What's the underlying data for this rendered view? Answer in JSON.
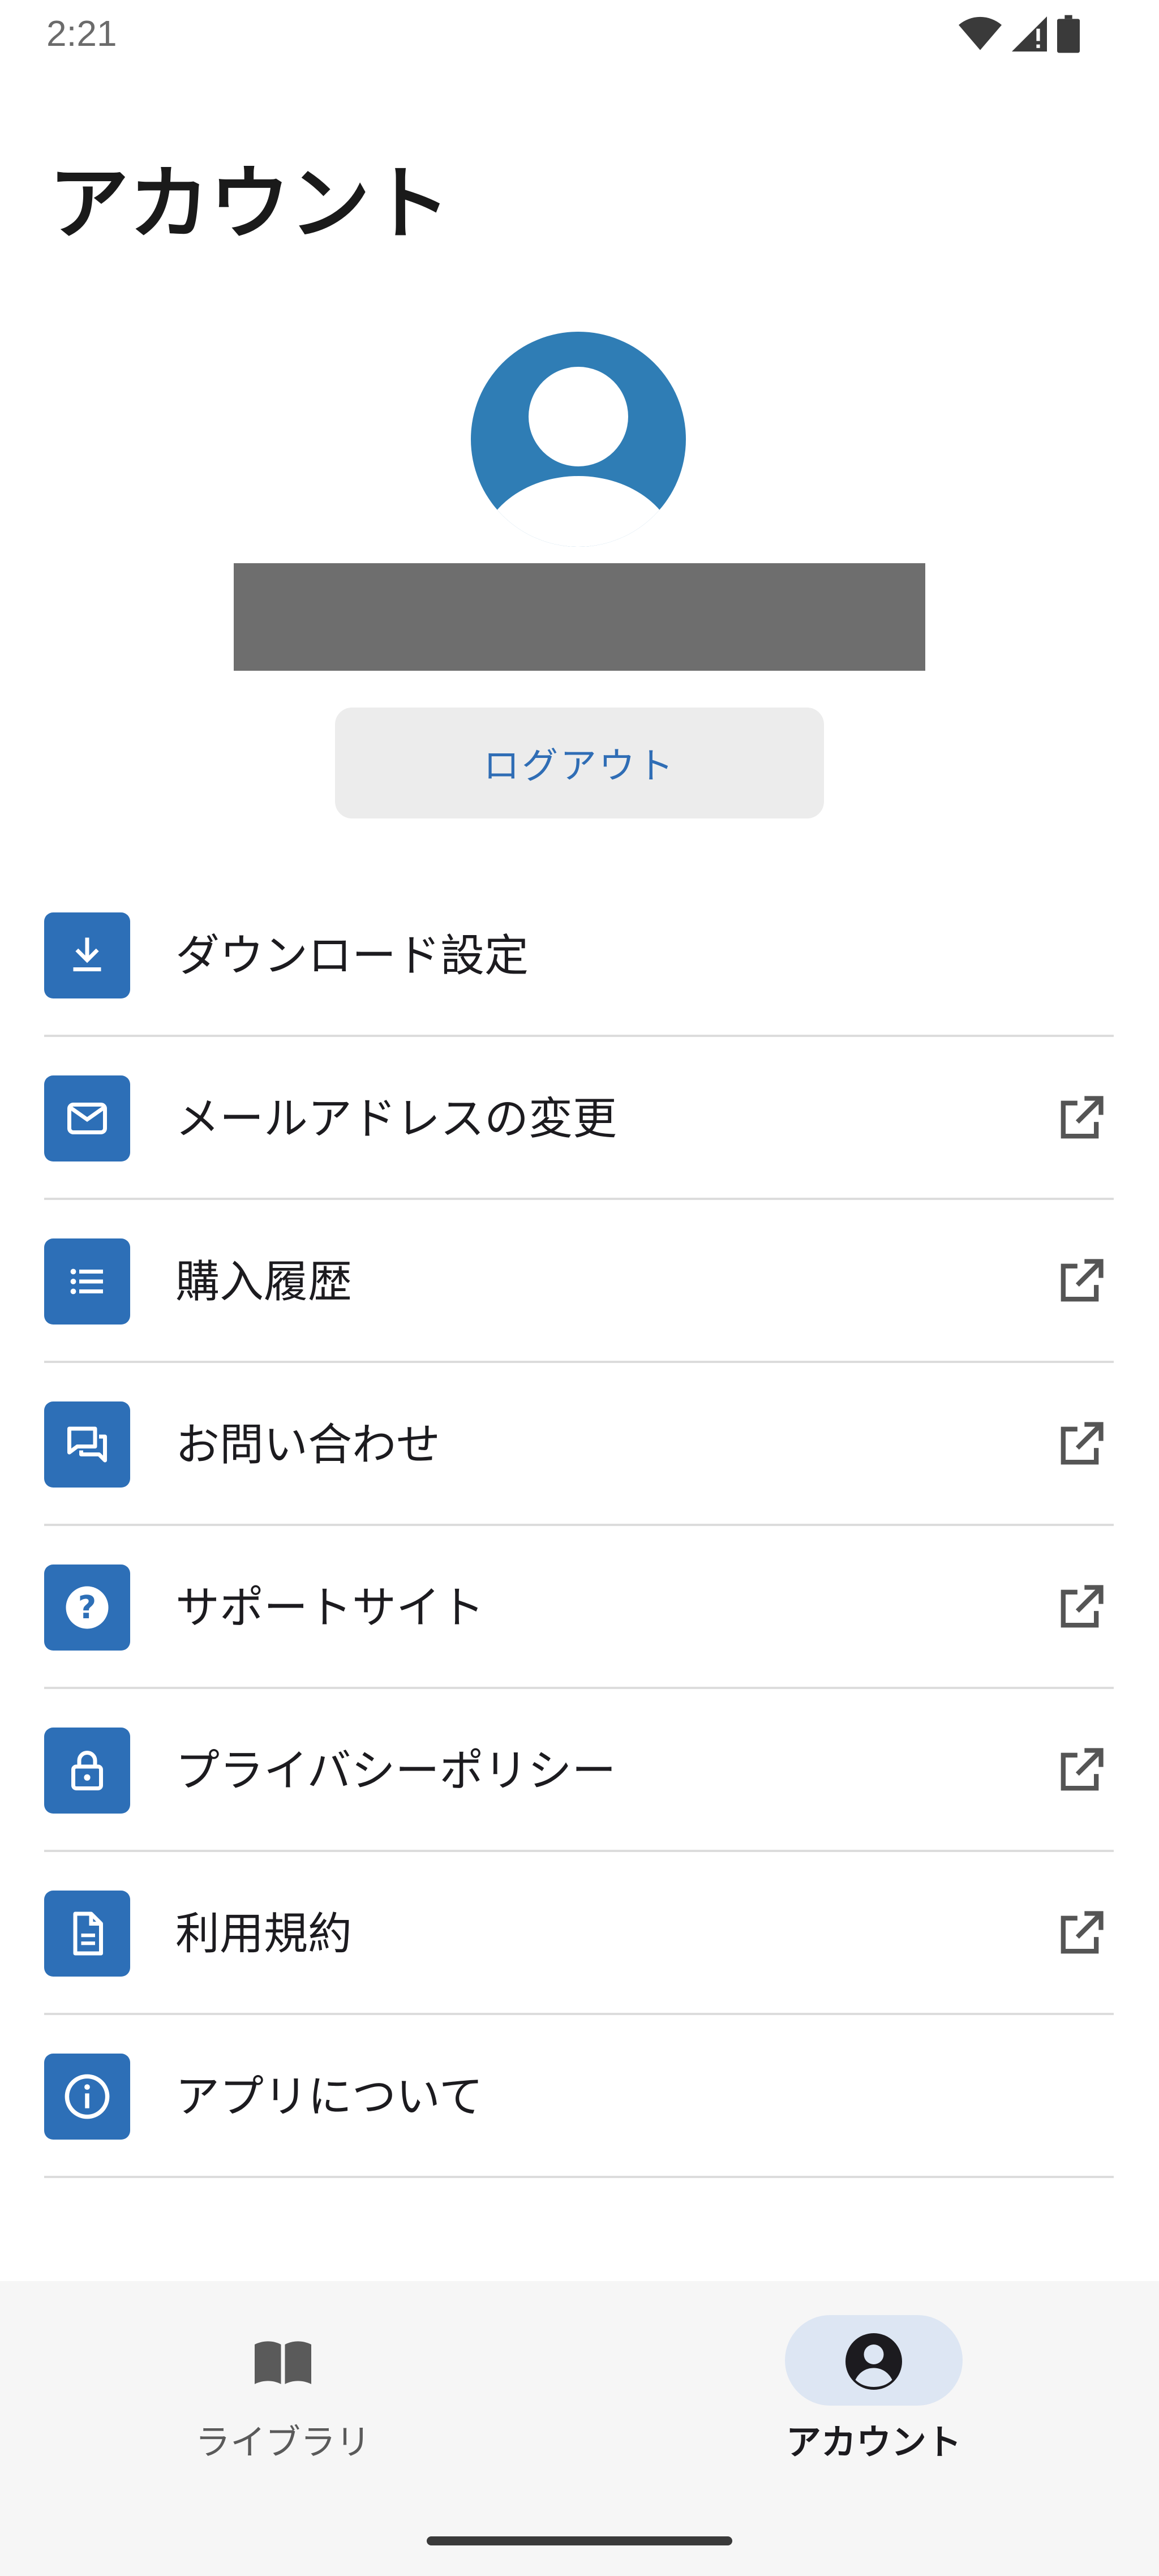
{
  "status_bar": {
    "time": "2:21",
    "icons": [
      "wifi-icon",
      "signal-icon",
      "battery-icon"
    ]
  },
  "page": {
    "title": "アカウント"
  },
  "profile": {
    "avatar_icon": "account-circle-icon",
    "accent_color": "#2f7db5"
  },
  "logout": {
    "label": "ログアウト"
  },
  "menu": {
    "items": [
      {
        "label": "ダウンロード設定",
        "icon": "download-icon",
        "external": false
      },
      {
        "label": "メールアドレスの変更",
        "icon": "mail-icon",
        "external": true
      },
      {
        "label": "購入履歴",
        "icon": "list-icon",
        "external": true
      },
      {
        "label": "お問い合わせ",
        "icon": "forum-icon",
        "external": true
      },
      {
        "label": "サポートサイト",
        "icon": "help-icon",
        "external": true
      },
      {
        "label": "プライバシーポリシー",
        "icon": "lock-icon",
        "external": true
      },
      {
        "label": "利用規約",
        "icon": "document-icon",
        "external": true
      },
      {
        "label": "アプリについて",
        "icon": "info-icon",
        "external": false
      }
    ],
    "icon_color": "#2d6fb7"
  },
  "bottom_nav": {
    "items": [
      {
        "label": "ライブラリ",
        "icon": "book-icon",
        "selected": false
      },
      {
        "label": "アカウント",
        "icon": "account-circle-icon",
        "selected": true
      }
    ]
  }
}
